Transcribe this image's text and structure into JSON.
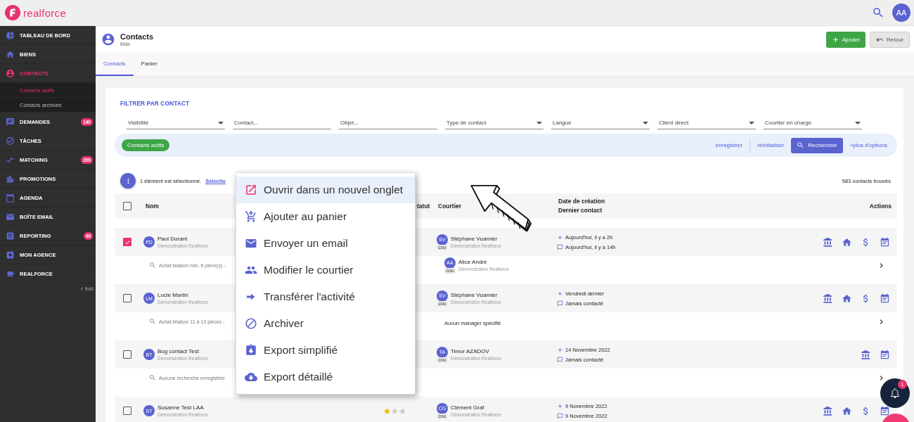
{
  "brand": {
    "name": "realforce"
  },
  "user": {
    "initials": "AA"
  },
  "sidebar": {
    "items": [
      {
        "label": "TABLEAU DE BORD",
        "selected": false
      },
      {
        "label": "BIENS",
        "selected": false
      },
      {
        "label": "CONTACTS",
        "selected": true,
        "children": [
          {
            "label": "Contacts actifs",
            "selected": true
          },
          {
            "label": "Contacts archivés",
            "selected": false
          }
        ]
      },
      {
        "label": "DEMANDES",
        "selected": false,
        "badge": "140"
      },
      {
        "label": "TÂCHES",
        "selected": false
      },
      {
        "label": "MATCHING",
        "selected": false,
        "badge": "209"
      },
      {
        "label": "PROMOTIONS",
        "selected": false
      },
      {
        "label": "AGENDA",
        "selected": false
      },
      {
        "label": "BOÎTE EMAIL",
        "selected": false
      },
      {
        "label": "REPORTING",
        "selected": false,
        "badge": "46"
      },
      {
        "label": "MON AGENCE",
        "selected": false
      },
      {
        "label": "REALFORCE",
        "selected": false
      }
    ],
    "fold": "fold"
  },
  "page_header": {
    "title": "Contacts",
    "subtitle": "liste",
    "buttons": [
      {
        "label": "Ajouter",
        "kind": "primary"
      },
      {
        "label": "Retour",
        "kind": "back"
      }
    ]
  },
  "tabs": [
    {
      "label": "Contacts",
      "selected": true
    },
    {
      "label": "Panier",
      "selected": false
    }
  ],
  "filter": {
    "title": "FILTRER PAR CONTACT",
    "fields": [
      {
        "kind": "select",
        "label": "Visibilité"
      },
      {
        "kind": "text",
        "placeholder": "Contact..."
      },
      {
        "kind": "text",
        "placeholder": "Objet..."
      },
      {
        "kind": "select",
        "label": "Type de contact"
      },
      {
        "kind": "select",
        "label": "Langue"
      },
      {
        "kind": "select",
        "label": "Client direct"
      },
      {
        "kind": "select",
        "label": "Courtier en charge"
      }
    ],
    "chip": "Contacts actifs",
    "links": [
      "enregistrer",
      "réinitialiser"
    ],
    "search_button": "Rechercher",
    "more_options": "+plus d'options"
  },
  "selection": {
    "text": "1 élément est sélectionné.",
    "link": "Sélectio",
    "count": "583 contacts trouvés"
  },
  "table": {
    "select_all_checked": false,
    "columns": [
      {
        "lines": [
          "Nom"
        ]
      },
      {
        "lines": [
          "tatut"
        ]
      },
      {
        "lines": [
          "Courtier"
        ]
      },
      {
        "lines": [
          "Date de création",
          "Dernier contact"
        ]
      },
      {
        "lines": [
          "Actions"
        ]
      }
    ],
    "rows": [
      {
        "checked": true,
        "initials": "PD",
        "name": "Paul Durant",
        "agency": "Démonstration Realforce",
        "search": "Achat Maison min. 6 pièce(s) -",
        "broker": {
          "initials": "SV",
          "name": "Stéphane Vuarnier",
          "agency": "Démonstration Realforce",
          "badge": "cou"
        },
        "manager": {
          "initials": "AA",
          "name": "Alice André",
          "agency": "Démonstration Realforce",
          "badge": "cou"
        },
        "created": "Aujourd'hui, il y a 2h",
        "last_contact": "Aujourd'hui, il y a 14h",
        "actions": [
          {
            "kind": "bank"
          },
          {
            "kind": "house"
          },
          {
            "kind": "price"
          },
          {
            "kind": "calendar"
          }
        ]
      },
      {
        "checked": false,
        "initials": "LM",
        "name": "Lucie Martin",
        "agency": "Démonstration Realforce",
        "search": "Achat Maison 11 à 13 pièces -",
        "broker": {
          "initials": "SV",
          "name": "Stéphane Vuarnier",
          "agency": "Démonstration Realforce",
          "badge": "cou"
        },
        "manager_note": "Aucun manager spécifié",
        "created": "Vendredi dernier",
        "last_contact": "Jamais contacté",
        "actions": [
          {
            "kind": "bank"
          },
          {
            "kind": "house"
          },
          {
            "kind": "price"
          },
          {
            "kind": "calendar"
          }
        ]
      },
      {
        "checked": false,
        "initials": "BT",
        "name": "Bug contact Test",
        "agency": "Démonstration Realforce",
        "search": "Aucune recherche enregistrée",
        "broker": {
          "initials": "TA",
          "name": "Timur AZADOV",
          "agency": "Démonstration Realforce",
          "badge": "cou"
        },
        "created": "14 Novembre 2022",
        "last_contact": "Jamais contacté",
        "actions": [
          {
            "kind": "bank"
          },
          {
            "kind": "calendar"
          }
        ]
      },
      {
        "checked": false,
        "initials": "ST",
        "name": "Susanne Test LAA",
        "agency": "Démonstration Realforce",
        "stars": 1,
        "broker": {
          "initials": "CG",
          "name": "Clément Graf",
          "agency": "Démonstration Realforce",
          "badge": "cou"
        },
        "created": "9 Novembre 2022",
        "last_contact": "9 Novembre 2022",
        "actions": [
          {
            "kind": "bank"
          },
          {
            "kind": "house"
          },
          {
            "kind": "price"
          },
          {
            "kind": "calendar"
          }
        ]
      }
    ]
  },
  "context_menu": {
    "items": [
      {
        "label": "Ouvrir dans un nouvel onglet",
        "selected": true
      },
      {
        "label": "Ajouter au panier",
        "selected": false
      },
      {
        "label": "Envoyer un email",
        "selected": false
      },
      {
        "label": "Modifier le courtier",
        "selected": false
      },
      {
        "label": "Transférer l'activité",
        "selected": false
      },
      {
        "label": "Archiver",
        "selected": false
      },
      {
        "label": "Export simplifié",
        "selected": false
      },
      {
        "label": "Export détaillé",
        "selected": false
      }
    ]
  },
  "notifications": {
    "count": "1"
  }
}
